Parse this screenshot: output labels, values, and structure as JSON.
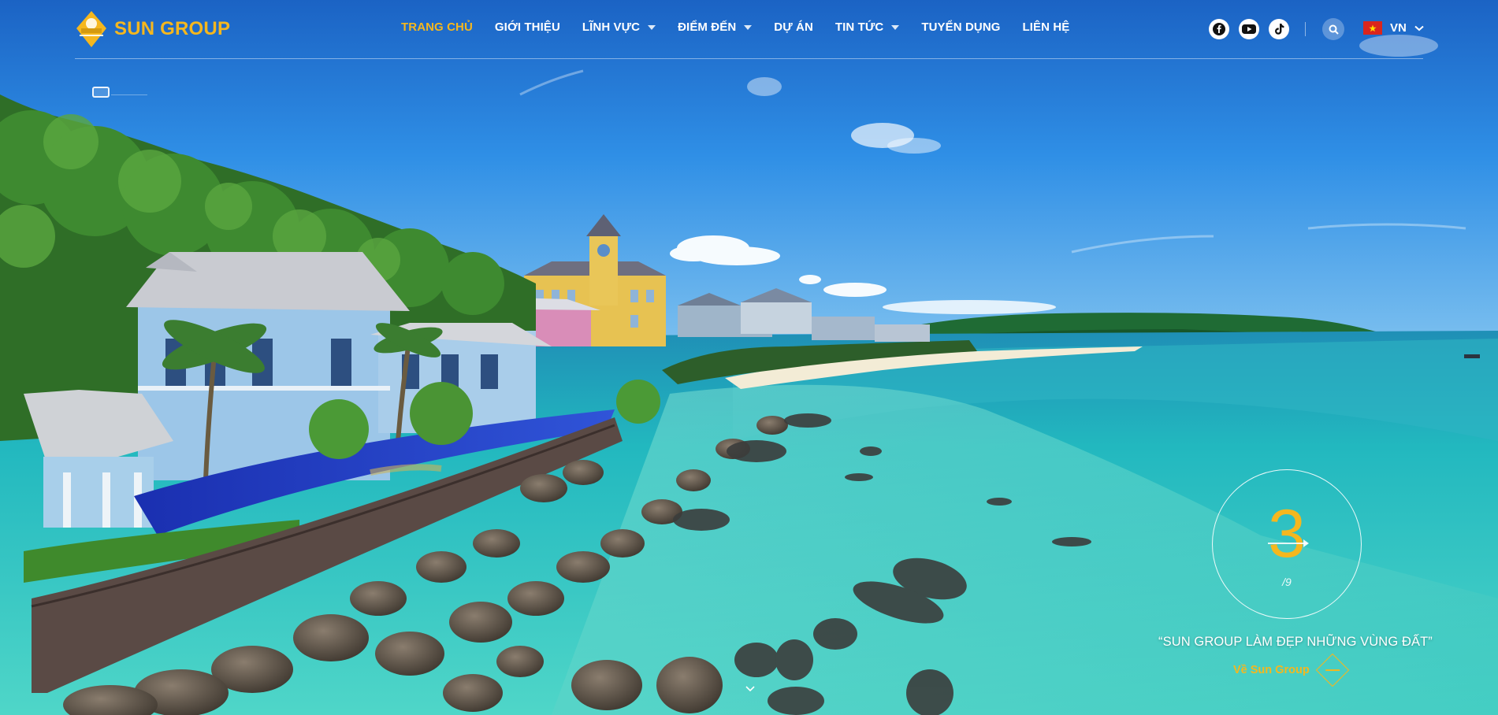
{
  "brand": {
    "name": "SUN GROUP",
    "accent_color": "#f5b71e"
  },
  "nav": {
    "items": [
      {
        "label": "TRANG CHỦ",
        "active": true,
        "has_dropdown": false
      },
      {
        "label": "GIỚI THIỆU",
        "active": false,
        "has_dropdown": false
      },
      {
        "label": "LĨNH VỰC",
        "active": false,
        "has_dropdown": true
      },
      {
        "label": "ĐIỂM ĐẾN",
        "active": false,
        "has_dropdown": true
      },
      {
        "label": "DỰ ÁN",
        "active": false,
        "has_dropdown": false
      },
      {
        "label": "TIN TỨC",
        "active": false,
        "has_dropdown": true
      },
      {
        "label": "TUYỂN DỤNG",
        "active": false,
        "has_dropdown": false
      },
      {
        "label": "LIÊN HỆ",
        "active": false,
        "has_dropdown": false
      }
    ]
  },
  "social": {
    "icons": [
      "facebook-icon",
      "youtube-icon",
      "tiktok-icon"
    ]
  },
  "search": {
    "icon": "search-icon"
  },
  "language": {
    "code": "VN",
    "flag": "vietnam-flag-icon"
  },
  "slider": {
    "current": "3",
    "total": "/9",
    "tagline": "“SUN GROUP LÀM ĐẸP NHỮNG VÙNG ĐẤT”",
    "link_label": "Về Sun Group"
  }
}
